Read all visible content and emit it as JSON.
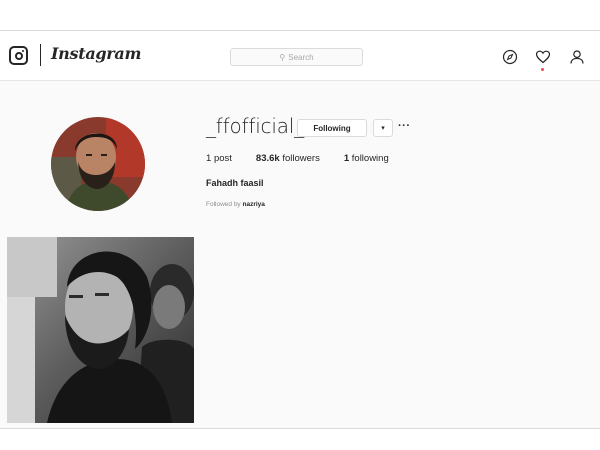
{
  "app": {
    "wordmark": "Instagram"
  },
  "search": {
    "placeholder": "Search",
    "icon": "search-icon"
  },
  "nav": {
    "icons": [
      "compass-icon",
      "heart-icon",
      "person-icon"
    ],
    "notification_dot_color": "#ed4956"
  },
  "profile": {
    "username": "_ffofficial_",
    "follow_button_label": "Following",
    "dropdown_label": "▾",
    "more_label": "···",
    "stats": {
      "posts_count": "1",
      "posts_label": "post",
      "followers_count": "83.6k",
      "followers_label": "followers",
      "following_count": "1",
      "following_label": "following"
    },
    "full_name": "Fahadh faasil",
    "followed_by_prefix": "Followed by",
    "followed_by_name": "nazriya"
  },
  "colors": {
    "accent_text": "#262626",
    "muted_text": "#8e8e8e",
    "border": "#dbdbdb",
    "background": "#fafafa"
  }
}
